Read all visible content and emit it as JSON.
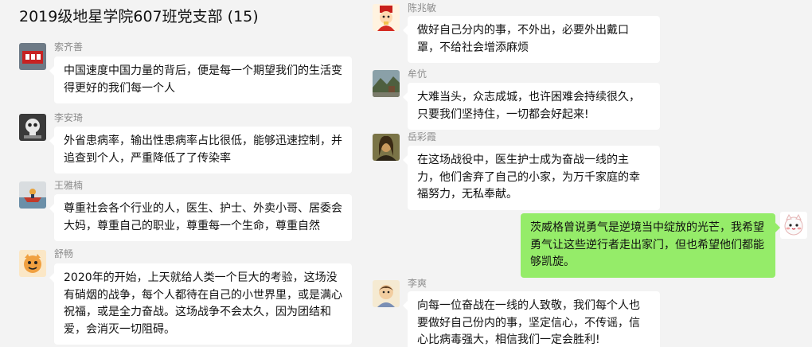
{
  "chat": {
    "title": "2019级地星学院607班党支部 (15)"
  },
  "left_messages": [
    {
      "sender": "索齐善",
      "avatar_icon": "red-sign-avatar-icon",
      "text": "中国速度中国力量的背后，便是每一个期望我们的生活变得更好的我们每一个人"
    },
    {
      "sender": "李安琦",
      "avatar_icon": "skull-avatar-icon",
      "text": "外省患病率，输出性患病率占比很低，能够迅速控制，并追查到个人，严重降低了了传染率"
    },
    {
      "sender": "王雅楠",
      "avatar_icon": "boat-photo-avatar-icon",
      "text": "尊重社会各个行业的人，医生、护士、外卖小哥、居委会大妈，尊重自己的职业，尊重每一个生命，尊重自然"
    },
    {
      "sender": "舒畅",
      "avatar_icon": "cartoon-cat-avatar-icon",
      "text": "2020年的开始，上天就给人类一个巨大的考验，这场没有硝烟的战争，每个人都待在自己的小世界里，或是满心祝福，或是全力奋战。这场战争不会太久，因为团结和爱，会消灭一切阻碍。"
    }
  ],
  "right_messages": [
    {
      "sender": "陈兆敏",
      "avatar_icon": "cartoon-god-avatar-icon",
      "text": "做好自己分内的事，不外出，必要外出戴口罩，不给社会增添麻烦",
      "mine": false
    },
    {
      "sender": "牟伉",
      "avatar_icon": "landscape-photo-avatar-icon",
      "text": "大难当头，众志成城，也许困难会持续很久，只要我们坚持住，一切都会好起来!",
      "mine": false
    },
    {
      "sender": "岳彩霞",
      "avatar_icon": "mona-lisa-avatar-icon",
      "text": "在这场战役中，医生护士成为奋战一线的主力，他们舍弃了自己的小家，为万千家庭的幸福努力，无私奉献。",
      "mine": false
    },
    {
      "sender": "",
      "avatar_icon": "white-cat-avatar-icon",
      "text": "茨威格曾说勇气是逆境当中绽放的光芒，我希望勇气让这些逆行者走出家门，但也希望他们都能够凯旋。",
      "mine": true
    },
    {
      "sender": "李爽",
      "avatar_icon": "cartoon-character-avatar-icon",
      "text": "向每一位奋战在一线的人致敬，我们每个人也要做好自己份内的事，坚定信心，不传谣，信心比病毒强大，相信我们一定会胜利!",
      "mine": false
    }
  ],
  "colors": {
    "background": "#f3f3f3",
    "bubble": "#ffffff",
    "my_bubble": "#95ec69",
    "sender_name": "#8c8c8c"
  }
}
